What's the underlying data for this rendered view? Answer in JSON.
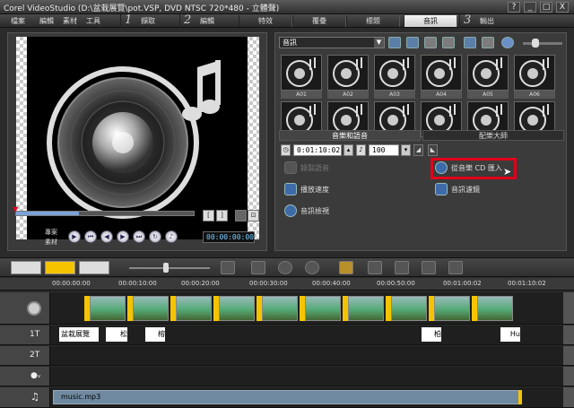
{
  "window": {
    "title": "Corel VideoStudio (D:\\盆栽展覽\\pot.VSP, DVD NTSC 720*480 - 立體聲)",
    "controls": [
      "?",
      "_",
      "□",
      "X"
    ]
  },
  "menu": {
    "items": [
      "檔案",
      "編輯",
      "素材",
      "工具"
    ]
  },
  "steps": [
    {
      "num": "1",
      "label": "擷取"
    },
    {
      "num": "2",
      "label": "編輯"
    },
    {
      "num": "3",
      "label": "輸出"
    }
  ],
  "edit_subtabs": [
    "特效",
    "覆疊",
    "標題",
    "音訊"
  ],
  "library": {
    "category": "音訊",
    "thumbs": [
      "A01",
      "A02",
      "A03",
      "A04",
      "A05",
      "A06"
    ]
  },
  "options": {
    "tabs": [
      "音樂和語音",
      "配樂大師"
    ],
    "duration": "0:01:10:02",
    "volume": "100",
    "features": {
      "record_voice": "錄製語音",
      "import_cd": "從音樂 CD 匯入",
      "playback_speed": "播放速度",
      "audio_filter": "音訊濾鏡",
      "audio_view": "音訊檢視"
    }
  },
  "preview": {
    "mode_project": "專案",
    "mode_clip": "素材",
    "timecode": "00:00:00:00",
    "bracket_start": "[",
    "bracket_end": "]"
  },
  "ruler": {
    "ticks": [
      "00:00:00:00",
      "00:00:10:00",
      "00:00:20:00",
      "00:00:30:00",
      "00:00:40:00",
      "00:00:50:00",
      "00:01:00:02",
      "00:01:10:02"
    ]
  },
  "tracks": {
    "title1": "1T",
    "title2": "2T",
    "title_clips": [
      "盆栽展覽",
      "松",
      "榕",
      "柏",
      "Hu"
    ],
    "music_clip": "music.mp3"
  },
  "colors": {
    "accent": "#f5c400",
    "highlight": "#e0001a",
    "music": "#6f8aa0"
  },
  "icons": [
    "music-note-icon",
    "folder-icon",
    "cd-icon",
    "speaker-icon",
    "film-icon"
  ]
}
